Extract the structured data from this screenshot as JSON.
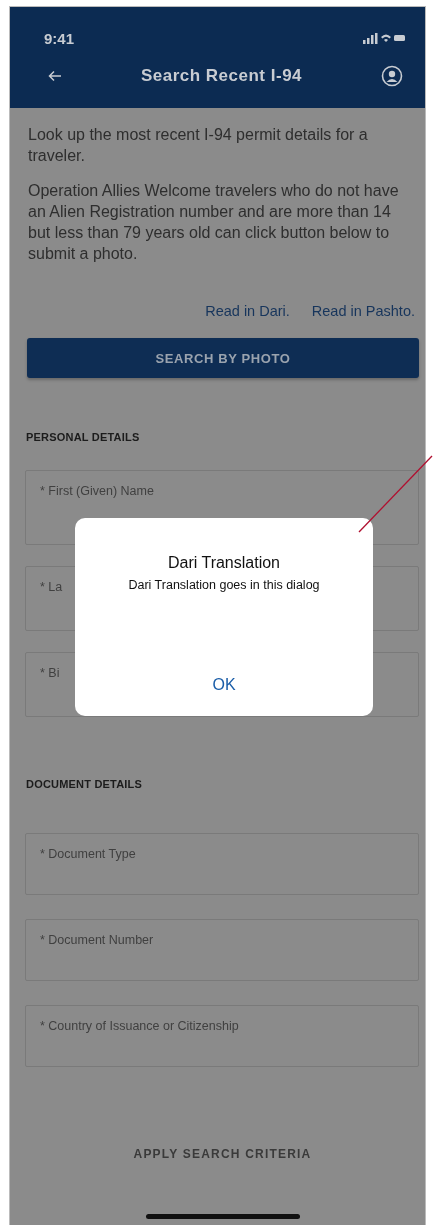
{
  "status_bar": {
    "time": "9:41"
  },
  "header": {
    "title": "Search Recent I-94"
  },
  "intro": [
    "Look up the most recent I-94 permit details for a traveler.",
    "Operation Allies Welcome travelers who do not have an Alien Registration number and are more than 14 but less than 79 years old can click button below to submit a photo."
  ],
  "links": [
    "Read in Dari.",
    "Read in Pashto."
  ],
  "photo_button": "SEARCH BY PHOTO",
  "sections": [
    {
      "title": "PERSONAL DETAILS",
      "fields": [
        {
          "label": "* First (Given) Name"
        },
        {
          "label": "* La"
        },
        {
          "label": "* Bi"
        }
      ]
    },
    {
      "title": "DOCUMENT DETAILS",
      "fields": [
        {
          "label": "* Document Type"
        },
        {
          "label": "* Document Number"
        },
        {
          "label": "* Country of Issuance or Citizenship"
        }
      ]
    }
  ],
  "apply_button": {
    "label": "APPLY SEARCH CRITERIA",
    "disabled": true
  },
  "dialog": {
    "title": "Dari Translation",
    "message": "Dari Translation goes in this dialog",
    "button": "OK"
  }
}
